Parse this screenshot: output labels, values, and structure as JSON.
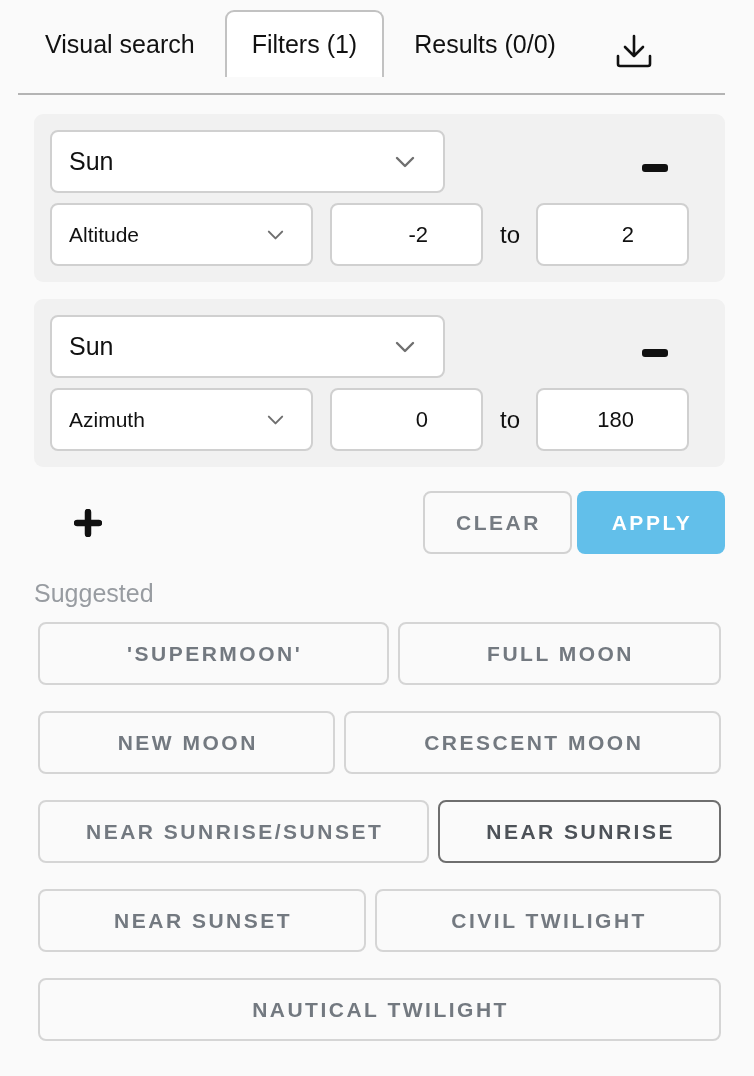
{
  "tabs": [
    {
      "label": "Visual search",
      "selected": false
    },
    {
      "label": "Filters (1)",
      "selected": true
    },
    {
      "label": "Results (0/0)",
      "selected": false
    }
  ],
  "filters": [
    {
      "object": "Sun",
      "property": "Altitude",
      "min": "-2",
      "separator": "to",
      "max": "2"
    },
    {
      "object": "Sun",
      "property": "Azimuth",
      "min": "0",
      "separator": "to",
      "max": "180"
    }
  ],
  "actions": [
    {
      "label": "CLEAR",
      "kind": "secondary"
    },
    {
      "label": "APPLY",
      "kind": "primary"
    }
  ],
  "suggested": {
    "title": "Suggested",
    "chips": [
      {
        "label": "'SUPERMOON'",
        "selected": false
      },
      {
        "label": "FULL MOON",
        "selected": false
      },
      {
        "label": "NEW MOON",
        "selected": false
      },
      {
        "label": "CRESCENT MOON",
        "selected": false
      },
      {
        "label": "NEAR SUNRISE/SUNSET",
        "selected": false
      },
      {
        "label": "NEAR SUNRISE",
        "selected": true
      },
      {
        "label": "NEAR SUNSET",
        "selected": false
      },
      {
        "label": "CIVIL TWILIGHT",
        "selected": false
      },
      {
        "label": "NAUTICAL TWILIGHT",
        "selected": false
      }
    ]
  }
}
